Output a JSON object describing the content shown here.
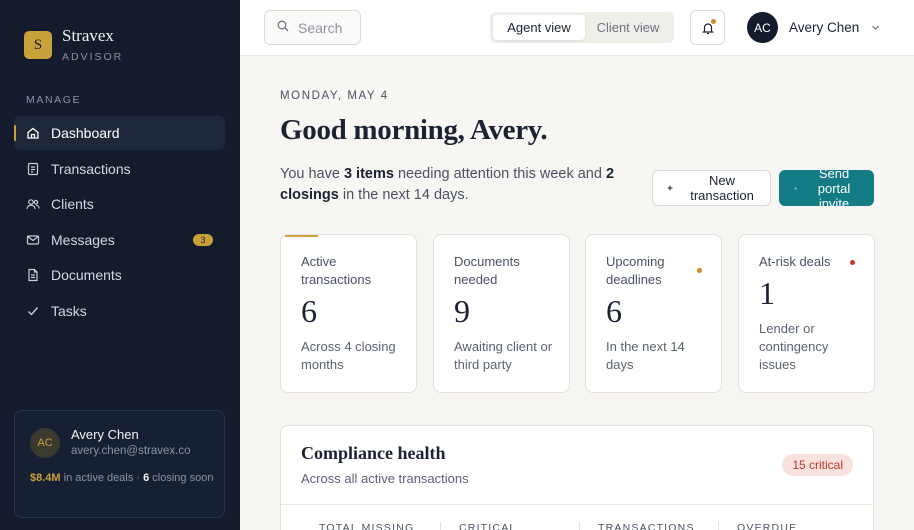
{
  "brand": {
    "initial": "S",
    "name": "Stravex",
    "subtitle": "ADVISOR"
  },
  "sidebar": {
    "section_label": "MANAGE",
    "items": [
      {
        "label": "Dashboard",
        "icon": "home-icon",
        "active": true
      },
      {
        "label": "Transactions",
        "icon": "transactions-icon"
      },
      {
        "label": "Clients",
        "icon": "users-icon"
      },
      {
        "label": "Messages",
        "icon": "mail-icon",
        "badge": "3"
      },
      {
        "label": "Documents",
        "icon": "document-icon"
      },
      {
        "label": "Tasks",
        "icon": "check-icon"
      }
    ],
    "user": {
      "initials": "AC",
      "name": "Avery Chen",
      "email": "avery.chen@stravex.co",
      "active_amount": "$8.4M",
      "active_text": " in active deals · ",
      "closing_count": "6",
      "closing_text": " closing soon"
    }
  },
  "topbar": {
    "search_placeholder": "Search",
    "views": [
      "Agent view",
      "Client view"
    ],
    "active_view": "Agent view",
    "user_initials": "AC",
    "user_name": "Avery Chen"
  },
  "main": {
    "date": "MONDAY, MAY 4",
    "greeting": "Good morning, Avery.",
    "summary": {
      "pre": "You have ",
      "items": "3 items",
      "mid": " needing attention this week and ",
      "closings": "2 closings",
      "post": " in the next 14 days."
    },
    "buttons": {
      "new_transaction": "New transaction",
      "send_invite": "Send portal invite"
    },
    "stats": [
      {
        "label": "Active transactions",
        "value": "6",
        "sub": "Across 4 closing months"
      },
      {
        "label": "Documents needed",
        "value": "9",
        "sub": "Awaiting client or third party"
      },
      {
        "label": "Upcoming deadlines",
        "value": "6",
        "sub": "In the next 14 days",
        "dot_color": "#d68a22"
      },
      {
        "label": "At-risk deals",
        "value": "1",
        "sub": "Lender or contingency issues",
        "dot_color": "#c0392b"
      }
    ],
    "compliance": {
      "title": "Compliance health",
      "subtitle": "Across all active transactions",
      "badge": "15 critical",
      "columns": [
        "TOTAL MISSING",
        "CRITICAL",
        "TRANSACTIONS",
        "OVERDUE"
      ]
    }
  },
  "colors": {
    "gold": "#c9a13b",
    "teal": "#127b86",
    "navy": "#131b2c",
    "critical": "#b23a2a",
    "warning": "#d68a22"
  }
}
